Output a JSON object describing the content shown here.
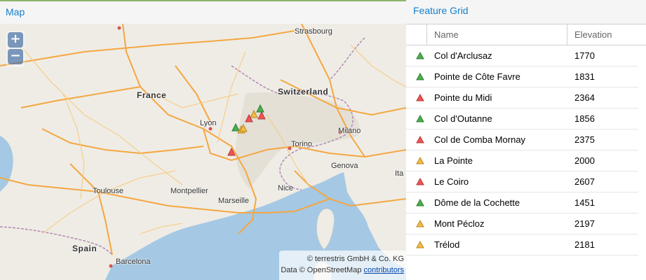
{
  "map": {
    "title": "Map",
    "zoom_in": "+",
    "zoom_out": "−",
    "attribution_line1": "© terrestris GmbH & Co. KG",
    "attribution_line2_prefix": "Data © OpenStreetMap",
    "attribution_link": "contributors",
    "labels": {
      "france": "France",
      "switzerland": "Switzerland",
      "spain": "Spain",
      "lyon": "Lyon",
      "strasbourg": "Strasbourg",
      "milano": "Milano",
      "torino": "Torino",
      "genova": "Genova",
      "toulouse": "Toulouse",
      "montpellier": "Montpellier",
      "marseille": "Marseille",
      "nice": "Nice",
      "barcelona": "Barcelona",
      "italia_fragment": "Ita"
    },
    "colors": {
      "sea": "#a5c8e4",
      "land": "#efece5",
      "highway": "#f4a742",
      "border": "#b18ab5",
      "marker_green": "#4caf50",
      "marker_red": "#f05454",
      "marker_orange": "#f5b942"
    }
  },
  "grid": {
    "title": "Feature Grid",
    "columns": {
      "name": "Name",
      "elevation": "Elevation"
    },
    "rows": [
      {
        "name": "Col d'Arclusaz",
        "elevation": "1770",
        "marker": "green"
      },
      {
        "name": "Pointe de Côte Favre",
        "elevation": "1831",
        "marker": "green"
      },
      {
        "name": "Pointe du Midi",
        "elevation": "2364",
        "marker": "red"
      },
      {
        "name": "Col d'Outanne",
        "elevation": "1856",
        "marker": "green"
      },
      {
        "name": "Col de Comba Mornay",
        "elevation": "2375",
        "marker": "red"
      },
      {
        "name": "La Pointe",
        "elevation": "2000",
        "marker": "orange"
      },
      {
        "name": "Le Coiro",
        "elevation": "2607",
        "marker": "red"
      },
      {
        "name": "Dôme de la Cochette",
        "elevation": "1451",
        "marker": "green"
      },
      {
        "name": "Mont Pécloz",
        "elevation": "2197",
        "marker": "orange"
      },
      {
        "name": "Trélod",
        "elevation": "2181",
        "marker": "orange"
      }
    ]
  }
}
